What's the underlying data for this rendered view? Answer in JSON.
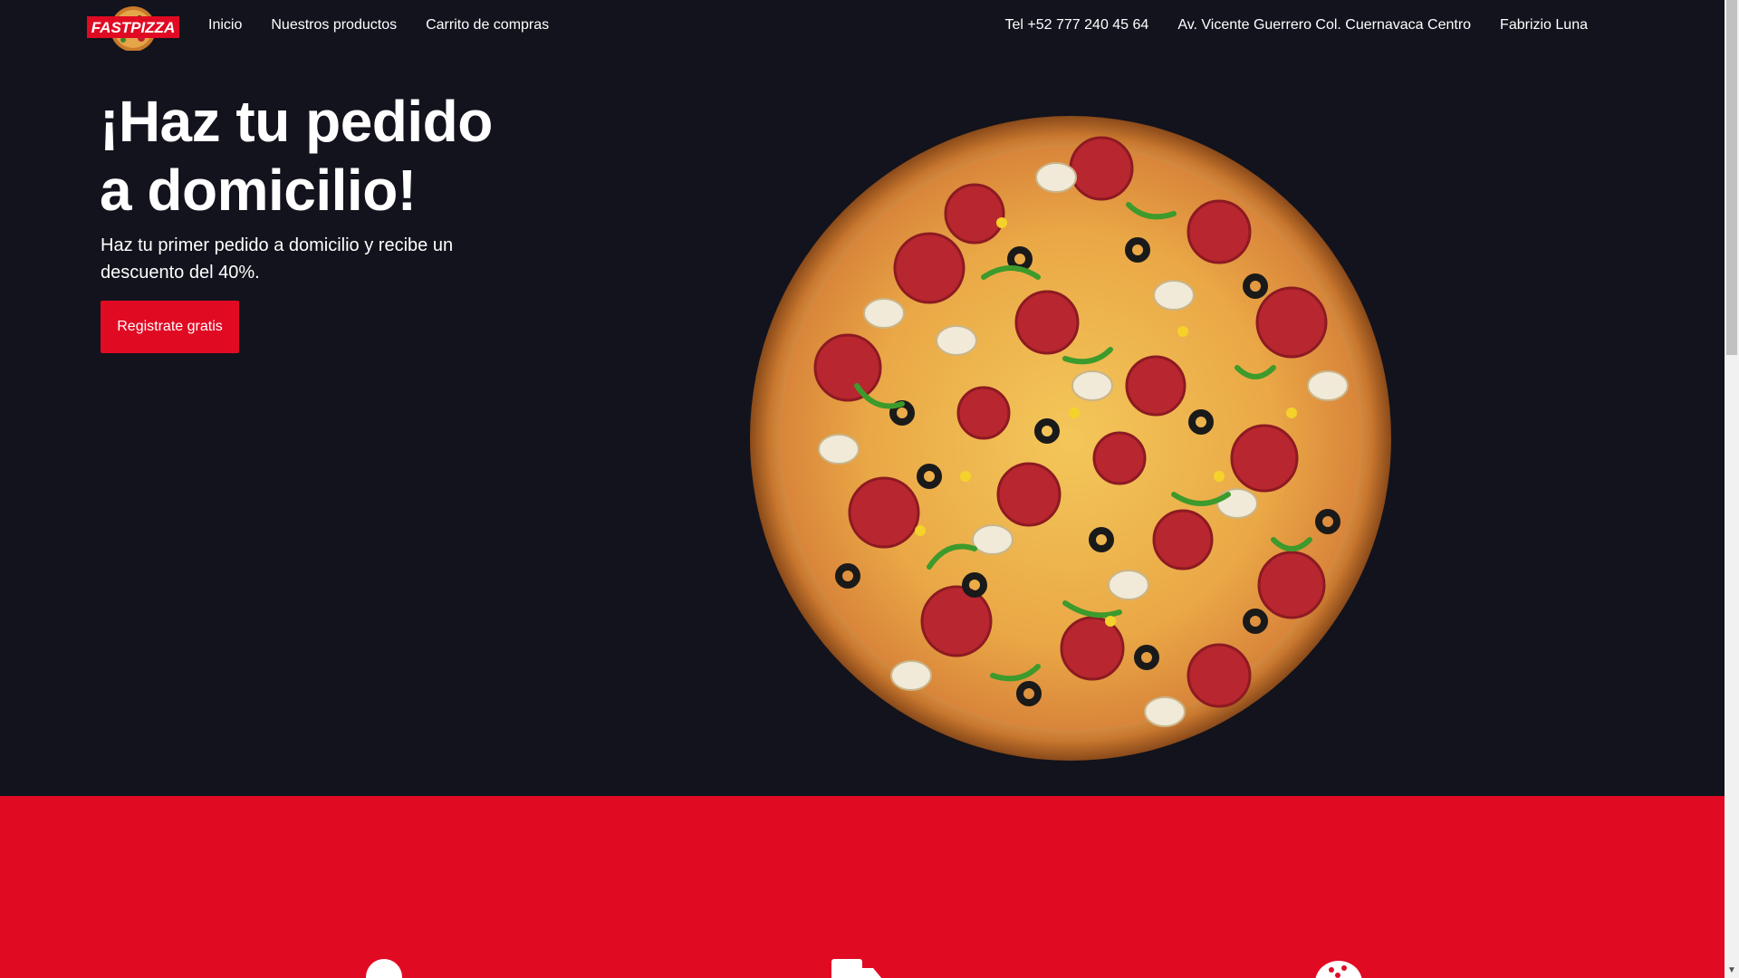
{
  "brand": {
    "logo_text": "FASTPIZZA"
  },
  "nav": {
    "left_links": [
      {
        "label": "Inicio"
      },
      {
        "label": "Nuestros productos"
      },
      {
        "label": "Carrito de compras"
      }
    ],
    "phone": "Tel +52 777 240 45 64",
    "address": "Av. Vicente Guerrero Col. Cuernavaca Centro",
    "user": "Fabrizio Luna"
  },
  "hero": {
    "title": "¡Haz tu pedido a domicilio!",
    "subtitle": "Haz tu primer pedido a domicilio y recibe un descuento del 40%.",
    "cta_label": "Registrate gratis"
  },
  "features": {
    "icons": [
      "user-icon",
      "delivery-truck-icon",
      "pizza-icon"
    ]
  },
  "colors": {
    "background": "#12131c",
    "accent": "#e10a23",
    "text": "#ffffff"
  }
}
